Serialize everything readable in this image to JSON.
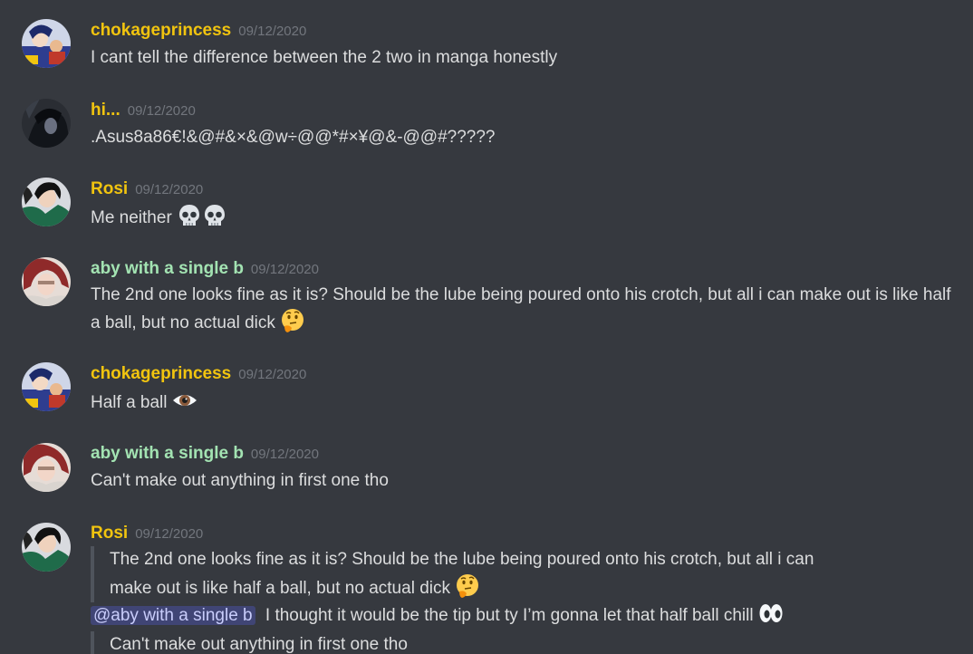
{
  "colors": {
    "background": "#36393f",
    "yellow_name": "#f1c40f",
    "green_name": "#a3e3b2",
    "timestamp": "#72767d",
    "text": "#dcddde",
    "mention_bg": "#4e5488"
  },
  "messages": [
    {
      "username": "chokageprincess",
      "timestamp": "09/12/2020",
      "text": "I cant tell the difference between the 2 two in manga honestly"
    },
    {
      "username": "hi...",
      "timestamp": "09/12/2020",
      "text": ".Asus8a86€!&@#&×&@w÷@@*#×¥@&-@@#?????"
    },
    {
      "username": "Rosi",
      "timestamp": "09/12/2020",
      "text": "Me neither",
      "emojis": [
        "skull-emoji",
        "skull-emoji"
      ]
    },
    {
      "username": "aby with a single b",
      "timestamp": "09/12/2020",
      "text": "The 2nd one looks fine as it is? Should be the lube being poured onto his crotch, but all i can make out is like half a ball, but no actual dick",
      "emojis": [
        "thinking-emoji"
      ]
    },
    {
      "username": "chokageprincess",
      "timestamp": "09/12/2020",
      "text": "Half a ball",
      "emojis": [
        "eye-emoji"
      ]
    },
    {
      "username": "aby with a single b",
      "timestamp": "09/12/2020",
      "text": "Can't make out anything in first one tho"
    },
    {
      "username": "Rosi",
      "timestamp": "09/12/2020",
      "quote1_line1": "The 2nd one looks fine as it is? Should be the lube being poured onto his crotch, but all i can",
      "quote1_line2": "make out is like half a ball, but no actual dick",
      "quote1_emoji": "thinking-emoji",
      "mention": "@aby with a single b",
      "reply": "I thought it would be the tip but ty I’m gonna let that half ball chill",
      "reply_emoji": "eyes-emoji",
      "quote2": "Can't make out anything in first one tho"
    }
  ]
}
